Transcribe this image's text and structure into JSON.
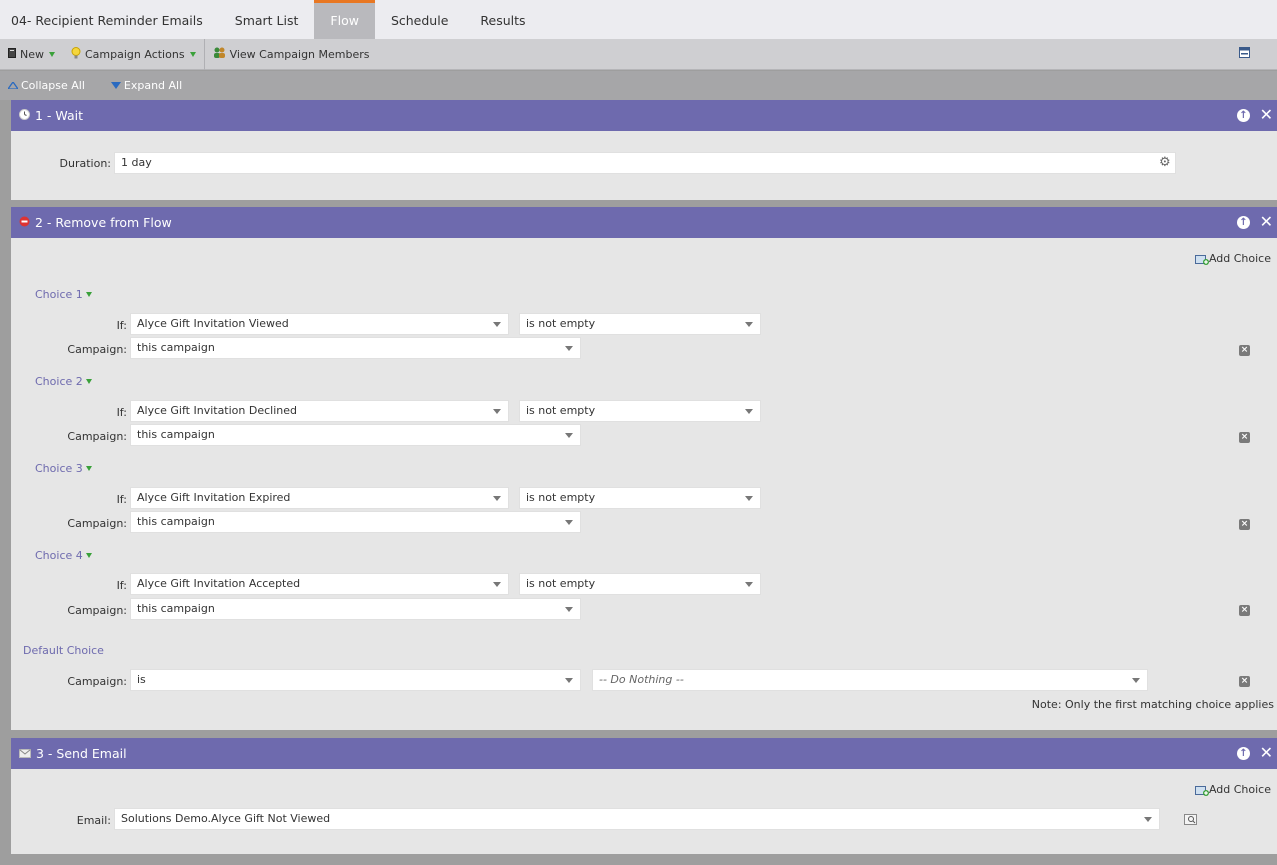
{
  "tabs": [
    {
      "label": "04- Recipient Reminder Emails"
    },
    {
      "label": "Smart List"
    },
    {
      "label": "Flow"
    },
    {
      "label": "Schedule"
    },
    {
      "label": "Results"
    }
  ],
  "toolbar": {
    "new_label": "New",
    "campaign_actions_label": "Campaign Actions",
    "view_members_label": "View Campaign Members"
  },
  "subbar": {
    "collapse_label": "Collapse All",
    "expand_label": "Expand All"
  },
  "step1": {
    "title": "1 - Wait",
    "duration_label": "Duration:",
    "duration_value": "1 day"
  },
  "step2": {
    "title": "2 - Remove from Flow",
    "add_choice_label": "Add Choice",
    "if_label": "If:",
    "campaign_label": "Campaign:",
    "choices": [
      {
        "label": "Choice 1",
        "if_value": "Alyce Gift Invitation Viewed",
        "operator": "is not empty",
        "campaign": "this campaign"
      },
      {
        "label": "Choice 2",
        "if_value": "Alyce Gift Invitation Declined",
        "operator": "is not empty",
        "campaign": "this campaign"
      },
      {
        "label": "Choice 3",
        "if_value": "Alyce Gift Invitation Expired",
        "operator": "is not empty",
        "campaign": "this campaign"
      },
      {
        "label": "Choice 4",
        "if_value": "Alyce Gift Invitation Accepted",
        "operator": "is not empty",
        "campaign": "this campaign"
      }
    ],
    "default_label": "Default Choice",
    "default_campaign": "is",
    "default_action": "-- Do Nothing --",
    "note": "Note: Only the first matching choice applies"
  },
  "step3": {
    "title": "3 - Send Email",
    "add_choice_label": "Add Choice",
    "email_label": "Email:",
    "email_value": "Solutions Demo.Alyce Gift Not Viewed"
  },
  "colors": {
    "step_header": "#6e6aae",
    "active_tab_accent": "#e87722"
  }
}
